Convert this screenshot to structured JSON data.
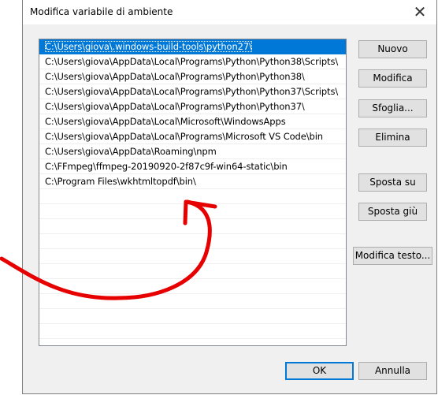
{
  "dialog": {
    "title": "Modifica variabile di ambiente",
    "close_glyph": "✕"
  },
  "paths": [
    "C:\\Users\\giova\\.windows-build-tools\\python27\\",
    "C:\\Users\\giova\\AppData\\Local\\Programs\\Python\\Python38\\Scripts\\",
    "C:\\Users\\giova\\AppData\\Local\\Programs\\Python\\Python38\\",
    "C:\\Users\\giova\\AppData\\Local\\Programs\\Python\\Python37\\Scripts\\",
    "C:\\Users\\giova\\AppData\\Local\\Programs\\Python\\Python37\\",
    "C:\\Users\\giova\\AppData\\Local\\Microsoft\\WindowsApps",
    "C:\\Users\\giova\\AppData\\Local\\Programs\\Microsoft VS Code\\bin",
    "C:\\Users\\giova\\AppData\\Roaming\\npm",
    "C:\\FFmpeg\\ffmpeg-20190920-2f87c9f-win64-static\\bin",
    "C:\\Program Files\\wkhtmltopdf\\bin\\"
  ],
  "empty_rows": 10,
  "selected_index": 0,
  "buttons": {
    "nuovo": "Nuovo",
    "modifica": "Modifica",
    "sfoglia": "Sfoglia...",
    "elimina": "Elimina",
    "sposta_su": "Sposta su",
    "sposta_giu": "Sposta giù",
    "modifica_testo": "Modifica testo...",
    "ok": "OK",
    "annulla": "Annulla"
  },
  "colors": {
    "selection": "#0078d7",
    "annotation_arrow": "#e60000"
  }
}
